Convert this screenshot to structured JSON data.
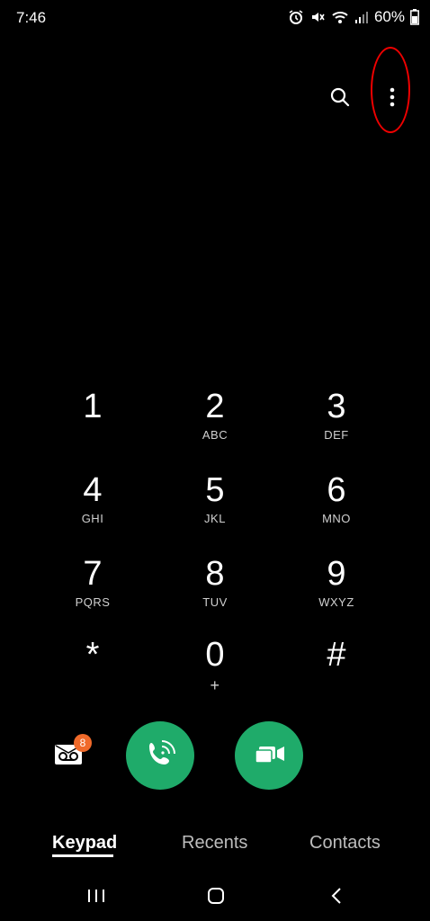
{
  "status_bar": {
    "time": "7:46",
    "battery": "60%",
    "icons": [
      "alarm-icon",
      "mute-icon",
      "wifi-icon",
      "signal-icon",
      "battery-icon"
    ]
  },
  "header": {
    "search_icon": "search-icon",
    "more_icon": "more-vertical-icon",
    "annotation_color": "#e00000"
  },
  "keypad": {
    "keys": [
      {
        "digit": "1",
        "letters": ""
      },
      {
        "digit": "2",
        "letters": "ABC"
      },
      {
        "digit": "3",
        "letters": "DEF"
      },
      {
        "digit": "4",
        "letters": "GHI"
      },
      {
        "digit": "5",
        "letters": "JKL"
      },
      {
        "digit": "6",
        "letters": "MNO"
      },
      {
        "digit": "7",
        "letters": "PQRS"
      },
      {
        "digit": "8",
        "letters": "TUV"
      },
      {
        "digit": "9",
        "letters": "WXYZ"
      },
      {
        "digit": "*",
        "letters": ""
      },
      {
        "digit": "0",
        "letters": "+"
      },
      {
        "digit": "#",
        "letters": ""
      }
    ]
  },
  "actions": {
    "voicemail_badge": "8",
    "call_color": "#1fab6a",
    "voicemail_icon": "voicemail-icon",
    "wifi_call_icon": "wifi-call-icon",
    "video_call_icon": "video-call-icon"
  },
  "tabs": [
    {
      "label": "Keypad",
      "active": true
    },
    {
      "label": "Recents",
      "active": false
    },
    {
      "label": "Contacts",
      "active": false
    }
  ],
  "navbar": {
    "items": [
      "recent-apps-icon",
      "home-icon",
      "back-icon"
    ]
  }
}
